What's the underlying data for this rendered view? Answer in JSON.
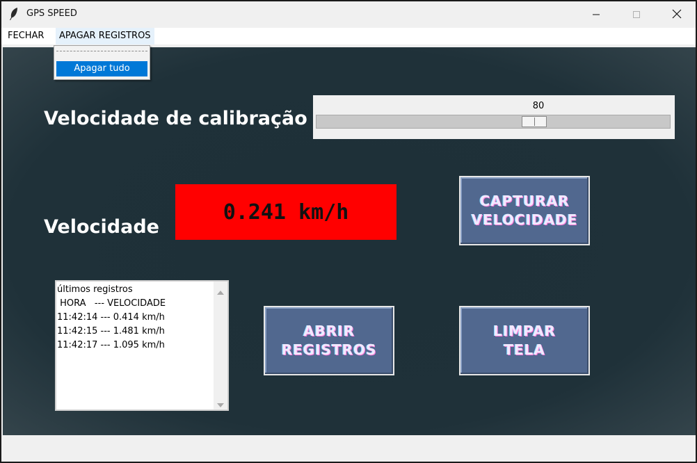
{
  "window": {
    "title": "GPS SPEED",
    "icon": "feather-icon",
    "controls": [
      "minimize-icon",
      "maximize-icon",
      "close-icon"
    ]
  },
  "menubar": {
    "items": [
      {
        "label": "FECHAR"
      },
      {
        "label": "APAGAR REGISTROS",
        "open": true
      }
    ]
  },
  "dropdown": {
    "items": [
      {
        "label": "Apagar tudo",
        "highlighted": true
      }
    ]
  },
  "calibration": {
    "label": "Velocidade de calibração",
    "value": "80",
    "slider_fraction": 0.625
  },
  "speed": {
    "label": "Velocidade",
    "display": "0.241 km/h",
    "display_color": "#ff0000"
  },
  "buttons": {
    "capture": "CAPTURAR\nVELOCIDADE",
    "open_records": "ABRIR\nREGISTROS",
    "clear_screen": "LIMPAR\nTELA"
  },
  "records": {
    "lines": [
      "últimos registros",
      " HORA   --- VELOCIDADE",
      "11:42:14 --- 0.414 km/h",
      "11:42:15 --- 1.481 km/h",
      "11:42:17 --- 1.095 km/h"
    ]
  },
  "colors": {
    "background": "#1f3139",
    "button": "#51688f",
    "menu_highlight": "#0078d7"
  }
}
